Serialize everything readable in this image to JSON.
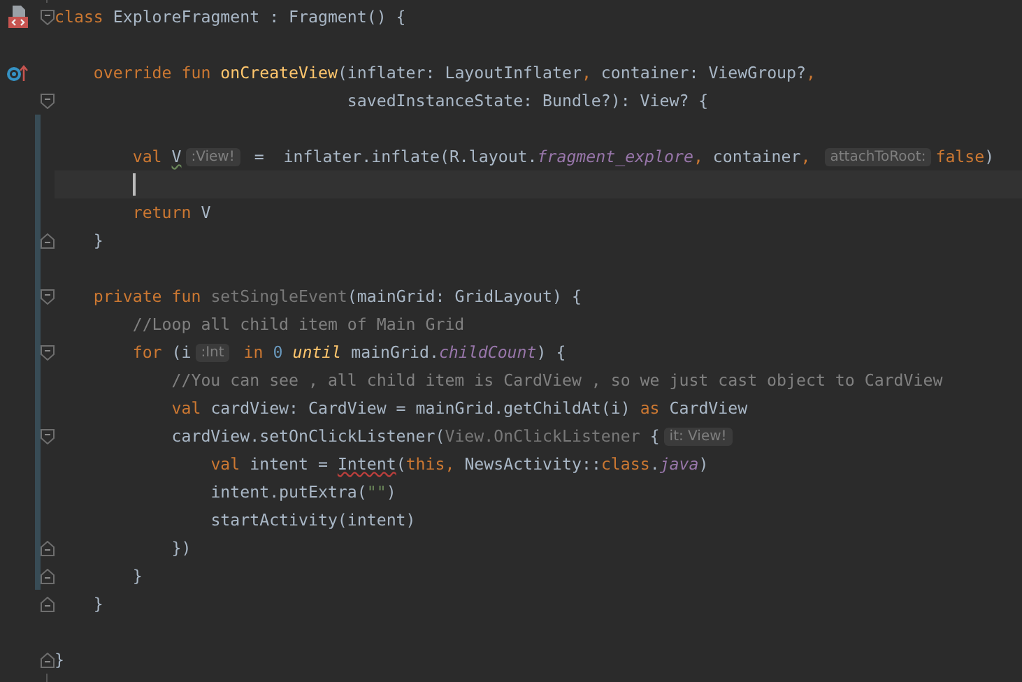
{
  "editor": {
    "lines": [
      {
        "marker": {
          "kind": "class"
        },
        "fold": {
          "kind": "start"
        },
        "changed": false,
        "current": false,
        "caret": false,
        "tokens": [
          {
            "kind": "keyword",
            "text": "class "
          },
          {
            "kind": "text",
            "text": "ExploreFragment : Fragment() {"
          }
        ]
      },
      {
        "changed": false,
        "current": false,
        "caret": false
      },
      {
        "marker": {
          "kind": "override"
        },
        "changed": false,
        "current": false,
        "caret": false,
        "tokens": [
          {
            "kind": "keyword",
            "text": "    override fun "
          },
          {
            "kind": "function",
            "text": "onCreateView"
          },
          {
            "kind": "text",
            "text": "(inflater: LayoutInflater"
          },
          {
            "kind": "punct",
            "text": ", "
          },
          {
            "kind": "text",
            "text": "container: ViewGroup?"
          },
          {
            "kind": "punct",
            "text": ","
          }
        ]
      },
      {
        "fold": {
          "kind": "start"
        },
        "changed": false,
        "current": false,
        "caret": false,
        "tokens": [
          {
            "kind": "text",
            "text": "                              savedInstanceState: Bundle?): View? {"
          }
        ]
      },
      {
        "changed": true,
        "current": false,
        "caret": false
      },
      {
        "changed": true,
        "current": false,
        "caret": false,
        "tokens": [
          {
            "kind": "keyword",
            "text": "        val "
          },
          {
            "kind": "warning",
            "text": "V"
          },
          {
            "kind": "hint",
            "text": ":View!"
          },
          {
            "kind": "text",
            "text": " =  inflater.inflate(R.layout."
          },
          {
            "kind": "property",
            "text": "fragment_explore"
          },
          {
            "kind": "punct",
            "text": ", "
          },
          {
            "kind": "text",
            "text": "container"
          },
          {
            "kind": "punct",
            "text": ", "
          },
          {
            "kind": "hint",
            "text": "attachToRoot:"
          },
          {
            "kind": "keyword",
            "text": "false"
          },
          {
            "kind": "text",
            "text": ")"
          }
        ]
      },
      {
        "changed": true,
        "current": true,
        "caret": true
      },
      {
        "changed": true,
        "current": false,
        "caret": false,
        "tokens": [
          {
            "kind": "keyword",
            "text": "        return "
          },
          {
            "kind": "text",
            "text": "V"
          }
        ]
      },
      {
        "fold": {
          "kind": "end"
        },
        "changed": true,
        "current": false,
        "caret": false,
        "tokens": [
          {
            "kind": "text",
            "text": "    }"
          }
        ]
      },
      {
        "changed": true,
        "current": false,
        "caret": false
      },
      {
        "fold": {
          "kind": "start"
        },
        "changed": true,
        "current": false,
        "caret": false,
        "tokens": [
          {
            "kind": "keyword",
            "text": "    private fun "
          },
          {
            "kind": "muted",
            "text": "setSingleEvent"
          },
          {
            "kind": "text",
            "text": "(mainGrid: GridLayout) {"
          }
        ]
      },
      {
        "changed": true,
        "current": false,
        "caret": false,
        "tokens": [
          {
            "kind": "comment",
            "text": "        //Loop all child item of Main Grid"
          }
        ]
      },
      {
        "fold": {
          "kind": "start"
        },
        "changed": true,
        "current": false,
        "caret": false,
        "tokens": [
          {
            "kind": "keyword",
            "text": "        for "
          },
          {
            "kind": "text",
            "text": "(i"
          },
          {
            "kind": "hint",
            "text": ":Int"
          },
          {
            "kind": "keyword",
            "text": " in "
          },
          {
            "kind": "number",
            "text": "0"
          },
          {
            "kind": "infix",
            "text": " until"
          },
          {
            "kind": "text",
            "text": " mainGrid."
          },
          {
            "kind": "property",
            "text": "childCount"
          },
          {
            "kind": "text",
            "text": ") {"
          }
        ]
      },
      {
        "changed": true,
        "current": false,
        "caret": false,
        "tokens": [
          {
            "kind": "comment",
            "text": "            //You can see , all child item is CardView , so we just cast object to CardView"
          }
        ]
      },
      {
        "changed": true,
        "current": false,
        "caret": false,
        "tokens": [
          {
            "kind": "keyword",
            "text": "            val "
          },
          {
            "kind": "text",
            "text": "cardView: CardView = mainGrid.getChildAt(i) "
          },
          {
            "kind": "keyword",
            "text": "as "
          },
          {
            "kind": "text",
            "text": "CardView"
          }
        ]
      },
      {
        "fold": {
          "kind": "start"
        },
        "changed": true,
        "current": false,
        "caret": false,
        "tokens": [
          {
            "kind": "text",
            "text": "            cardView.setOnClickListener("
          },
          {
            "kind": "muted",
            "text": "View.OnClickListener"
          },
          {
            "kind": "text",
            "text": " {"
          },
          {
            "kind": "hint",
            "text": "it: View!"
          }
        ]
      },
      {
        "changed": true,
        "current": false,
        "caret": false,
        "tokens": [
          {
            "kind": "keyword",
            "text": "                val "
          },
          {
            "kind": "text",
            "text": "intent = "
          },
          {
            "kind": "error",
            "text": "Intent"
          },
          {
            "kind": "text",
            "text": "("
          },
          {
            "kind": "keyword",
            "text": "this"
          },
          {
            "kind": "punct",
            "text": ", "
          },
          {
            "kind": "text",
            "text": "NewsActivity::"
          },
          {
            "kind": "keyword",
            "text": "class"
          },
          {
            "kind": "text",
            "text": "."
          },
          {
            "kind": "property",
            "text": "java"
          },
          {
            "kind": "text",
            "text": ")"
          }
        ]
      },
      {
        "changed": true,
        "current": false,
        "caret": false,
        "tokens": [
          {
            "kind": "text",
            "text": "                intent.putExtra("
          },
          {
            "kind": "string",
            "text": "\"\""
          },
          {
            "kind": "text",
            "text": ")"
          }
        ]
      },
      {
        "changed": true,
        "current": false,
        "caret": false,
        "tokens": [
          {
            "kind": "text",
            "text": "                startActivity(intent)"
          }
        ]
      },
      {
        "fold": {
          "kind": "end"
        },
        "changed": true,
        "current": false,
        "caret": false,
        "tokens": [
          {
            "kind": "text",
            "text": "            })"
          }
        ]
      },
      {
        "fold": {
          "kind": "end"
        },
        "changed": true,
        "current": false,
        "caret": false,
        "tokens": [
          {
            "kind": "text",
            "text": "        }"
          }
        ]
      },
      {
        "fold": {
          "kind": "end"
        },
        "changed": false,
        "current": false,
        "caret": false,
        "tokens": [
          {
            "kind": "text",
            "text": "    }"
          }
        ]
      },
      {
        "changed": false,
        "current": false,
        "caret": false
      },
      {
        "fold": {
          "kind": "end"
        },
        "changed": false,
        "current": false,
        "caret": false,
        "tokens": [
          {
            "kind": "text",
            "text": "}"
          }
        ]
      }
    ]
  }
}
